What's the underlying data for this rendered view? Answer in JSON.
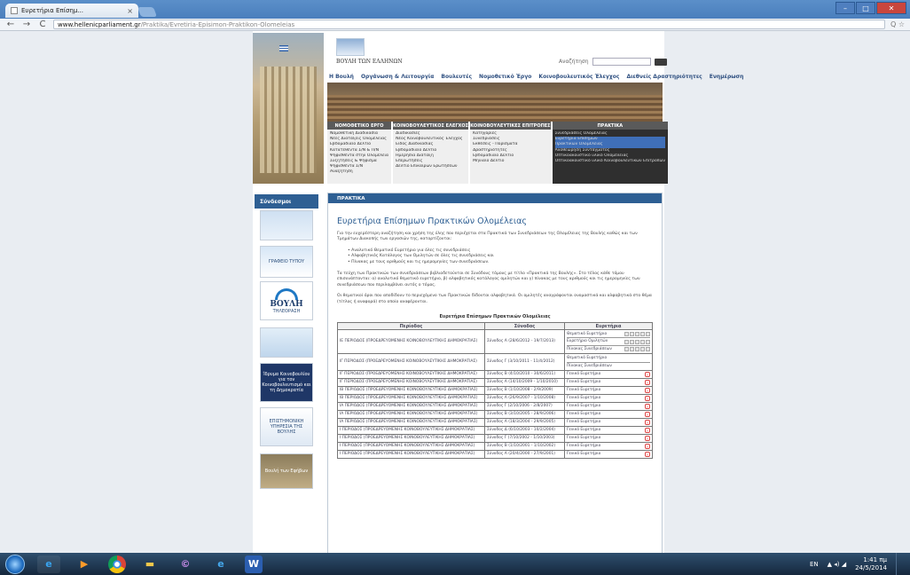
{
  "browser": {
    "tab_title": "Ευρετήρια Επίσημ...",
    "tab_close": "×",
    "back": "←",
    "forward": "→",
    "reload": "C",
    "url_host": "www.hellenicparliament.gr",
    "url_path": "/Praktika/Evretiria-Episimon-Praktikon-Olomeleias",
    "right_icons": "Q ☆"
  },
  "site": {
    "logo_text": "ΒΟΥΛΗ ΤΩΝ ΕΛΛΗΝΩΝ",
    "search_label": "Αναζήτηση",
    "topnav": [
      "Η Βουλή",
      "Οργάνωση & Λειτουργία",
      "Βουλευτές",
      "Νομοθετικό Έργο",
      "Κοινοβουλευτικός Έλεγχος",
      "Διεθνείς Δραστηριότητες",
      "Ενημέρωση"
    ],
    "menus": [
      {
        "header": "ΝΟΜΟΘΕΤΙΚΟ ΕΡΓΟ",
        "items": [
          "Νομοθετική Διαδικασία",
          "Νέες Διατάξεις Ολομέλειας",
          "Εβδομαδιαίο Δελτίο",
          "Κατατεθέντα Σ/Ν & Π/Ν",
          "Ψηφισθέντα στην Ολομέλεια",
          "Συζητήσεις & Ψήφισμα",
          "Ψηφισθέντα Σ/Ν",
          "Αναζήτηση"
        ],
        "selected": -1
      },
      {
        "header": "ΚΟΙΝΟΒΟΥΛΕΥΤΙΚΟΣ ΕΛΕΓΧΟΣ",
        "items": [
          "Διαδικασίες",
          "Νέος Κοινοβουλευτικός Έλεγχος",
          "Είδος Διαδικασίας",
          "Εβδομαδιαίο Δελτίο",
          "Ημερήσια Διάταξη",
          "Επερωτήσεις",
          "Δελτίο Επικαίρων Ερωτήσεων"
        ],
        "selected": -1
      },
      {
        "header": "ΚΟΙΝΟΒΟΥΛΕΥΤΙΚΕΣ ΕΠΙΤΡΟΠΕΣ",
        "items": [
          "Κατηγορίες",
          "Συνεδριάσεις",
          "Εκθέσεις - Πορίσματα",
          "Δραστηριότητες",
          "Εβδομαδιαίο Δελτίο",
          "Μηνιαίο Δελτίο"
        ],
        "selected": -1
      },
      {
        "header": "ΠΡΑΚΤΙΚΑ",
        "items": [
          "Συνεδριάσεις Ολομέλειας",
          "Ευρετήρια Επίσημων",
          "Πρακτικών Ολομέλειας",
          "Αναθεώρηση Συντάγματος",
          "Οπτικοακουστικό υλικό Ολομέλειας",
          "Οπτικοακουστικό υλικό Κοινοβουλευτικών Επιτροπών"
        ],
        "selected": 1
      }
    ],
    "sidebar": {
      "header": "Σύνδεσμοι",
      "banners": {
        "b1": "",
        "b2": "ΓΡΑΦΕΙΟ ΤΥΠΟΥ",
        "b3": "ΒΟΥΛΗ",
        "b3_sub": "ΤΗΛΕΟΡΑΣΗ",
        "b4": "",
        "b5": "Ίδρυμα Κοινοβουλίου για τον Κοινοβουλευτισμό και τη Δημοκρατία",
        "b6": "ΕΠΙΣΤΗΜΟΝΙΚΗ ΥΠΗΡΕΣΙΑ ΤΗΣ ΒΟΥΛΗΣ",
        "b7": "Βουλή των Εφήβων"
      }
    },
    "content": {
      "bar": "ΠΡΑΚΤΙΚΑ",
      "title": "Ευρετήρια Επίσημων Πρακτικών Ολομέλειας",
      "intro": "Για την ευχερέστερη αναζήτηση και χρήση της ύλης που περιέχεται στα Πρακτικά των Συνεδριάσεων της Ολομέλειας της Βουλής καθώς και των Τμημάτων Διακοπής των εργασιών της, καταρτίζονται:",
      "bullets": [
        "Αναλυτικό Θεματικό Ευρετήριο για όλες τις συνεδριάσεις",
        "Αλφαβητικός Κατάλογος των Ομιλητών σε όλες τις συνεδριάσεις και",
        "Πίνακας με τους αριθμούς και τις ημερομηνίες των συνεδριάσεων."
      ],
      "para2": "Τα τεύχη των Πρακτικών των συνεδριάσεων βιβλιοδετούνται σε Συνόδους τόμους με τίτλο «Πρακτικά της Βουλής». Στο τέλος κάθε τόμου επισυνάπτονται: α) αναλυτικό θεματικό ευρετήριο, β) αλφαβητικός κατάλογος ομιλητών και γ) πίνακας με τους αριθμούς και τις ημερομηνίες των συνεδριάσεων που περιλαμβάνει αυτός ο τόμος.",
      "para3": "Οι θεματικοί όροι που αποδίδουν το περιεχόμενο των Πρακτικών δίδονται αλφαβητικά. Οι ομιλητές αναγράφονται ονομαστικά και αλφαβητικά στο θέμα (τίτλος ή αναφορά) στο οποίο αναφέρονται.",
      "table_caption": "Ευρετήρια Επίσημων Πρακτικών Ολομέλειας",
      "table_headers": [
        "Περίοδος",
        "Σύνοδος",
        "Ευρετήρια"
      ],
      "special_rows": [
        {
          "period": "ΙΕ ΠΕΡΙΟΔΟΣ (ΠΡΟΕΔΡΕΥΟΜΕΝΗΣ ΚΟΙΝΟΒΟΥΛΕΥΤΙΚΗΣ ΔΗΜΟΚΡΑΤΙΑΣ)",
          "session": "Σύνοδος Α (28/6/2012 - 19/7/2013)",
          "subs": [
            "Θεματικό Ευρετήριο",
            "Ευρετήριο Ομιλητών",
            "Πίνακας Συνεδριάσεων"
          ]
        },
        {
          "period": "ΙΓ ΠΕΡΙΟΔΟΣ (ΠΡΟΕΔΡΕΥΟΜΕΝΗΣ ΚΟΙΝΟΒΟΥΛΕΥΤΙΚΗΣ ΔΗΜΟΚΡΑΤΙΑΣ)",
          "session": "Σύνοδος Γ (3/10/2011 - 11/4/2012)",
          "subs": [
            "Θεματικό Ευρετήριο",
            "Πίνακας Συνεδριάσεων"
          ]
        }
      ],
      "rows": [
        {
          "period": "ΙΓ ΠΕΡΙΟΔΟΣ (ΠΡΟΕΔΡΕΥΟΜΕΝΗΣ ΚΟΙΝΟΒΟΥΛΕΥΤΙΚΗΣ ΔΗΜΟΚΡΑΤΙΑΣ)",
          "session": "Σύνοδος Β (4/10/2010 - 30/6/2011)",
          "index": "Γενικό Ευρετήριο"
        },
        {
          "period": "ΙΓ ΠΕΡΙΟΔΟΣ (ΠΡΟΕΔΡΕΥΟΜΕΝΗΣ ΚΟΙΝΟΒΟΥΛΕΥΤΙΚΗΣ ΔΗΜΟΚΡΑΤΙΑΣ)",
          "session": "Σύνοδος Α (14/10/2009 - 1/10/2010)",
          "index": "Γενικό Ευρετήριο"
        },
        {
          "period": "ΙΒ ΠΕΡΙΟΔΟΣ (ΠΡΟΕΔΡΕΥΟΜΕΝΗΣ ΚΟΙΝΟΒΟΥΛΕΥΤΙΚΗΣ ΔΗΜΟΚΡΑΤΙΑΣ)",
          "session": "Σύνοδος Β (1/10/2008 - 2/9/2009)",
          "index": "Γενικό Ευρετήριο"
        },
        {
          "period": "ΙΒ ΠΕΡΙΟΔΟΣ (ΠΡΟΕΔΡΕΥΟΜΕΝΗΣ ΚΟΙΝΟΒΟΥΛΕΥΤΙΚΗΣ ΔΗΜΟΚΡΑΤΙΑΣ)",
          "session": "Σύνοδος Α (26/9/2007 - 1/10/2008)",
          "index": "Γενικό Ευρετήριο"
        },
        {
          "period": "ΙΑ ΠΕΡΙΟΔΟΣ (ΠΡΟΕΔΡΕΥΟΜΕΝΗΣ ΚΟΙΝΟΒΟΥΛΕΥΤΙΚΗΣ ΔΗΜΟΚΡΑΤΙΑΣ)",
          "session": "Σύνοδος Γ (2/10/2006 - 2/8/2007)",
          "index": "Γενικό Ευρετήριο"
        },
        {
          "period": "ΙΑ ΠΕΡΙΟΔΟΣ (ΠΡΟΕΔΡΕΥΟΜΕΝΗΣ ΚΟΙΝΟΒΟΥΛΕΥΤΙΚΗΣ ΔΗΜΟΚΡΑΤΙΑΣ)",
          "session": "Σύνοδος Β (3/10/2005 - 28/9/2006)",
          "index": "Γενικό Ευρετήριο"
        },
        {
          "period": "ΙΑ ΠΕΡΙΟΔΟΣ (ΠΡΟΕΔΡΕΥΟΜΕΝΗΣ ΚΟΙΝΟΒΟΥΛΕΥΤΙΚΗΣ ΔΗΜΟΚΡΑΤΙΑΣ)",
          "session": "Σύνοδος Α (18/3/2004 - 29/9/2005)",
          "index": "Γενικό Ευρετήριο"
        },
        {
          "period": "Ι ΠΕΡΙΟΔΟΣ (ΠΡΟΕΔΡΕΥΟΜΕΝΗΣ ΚΟΙΝΟΒΟΥΛΕΥΤΙΚΗΣ ΔΗΜΟΚΡΑΤΙΑΣ)",
          "session": "Σύνοδος Δ (6/10/2003 - 10/2/2004)",
          "index": "Γενικό Ευρετήριο"
        },
        {
          "period": "Ι ΠΕΡΙΟΔΟΣ (ΠΡΟΕΔΡΕΥΟΜΕΝΗΣ ΚΟΙΝΟΒΟΥΛΕΥΤΙΚΗΣ ΔΗΜΟΚΡΑΤΙΑΣ)",
          "session": "Σύνοδος Γ (7/10/2002 - 1/10/2003)",
          "index": "Γενικό Ευρετήριο"
        },
        {
          "period": "Ι ΠΕΡΙΟΔΟΣ (ΠΡΟΕΔΡΕΥΟΜΕΝΗΣ ΚΟΙΝΟΒΟΥΛΕΥΤΙΚΗΣ ΔΗΜΟΚΡΑΤΙΑΣ)",
          "session": "Σύνοδος Β (1/10/2001 - 1/10/2002)",
          "index": "Γενικό Ευρετήριο"
        },
        {
          "period": "Ι ΠΕΡΙΟΔΟΣ (ΠΡΟΕΔΡΕΥΟΜΕΝΗΣ ΚΟΙΝΟΒΟΥΛΕΥΤΙΚΗΣ ΔΗΜΟΚΡΑΤΙΑΣ)",
          "session": "Σύνοδος Α (20/4/2000 - 27/9/2001)",
          "index": "Γενικό Ευρετήριο"
        }
      ]
    }
  },
  "taskbar": {
    "lang": "EN",
    "tray_icons": "▲ ◂) ◢",
    "time": "1:41 πμ",
    "date": "24/5/2014"
  }
}
